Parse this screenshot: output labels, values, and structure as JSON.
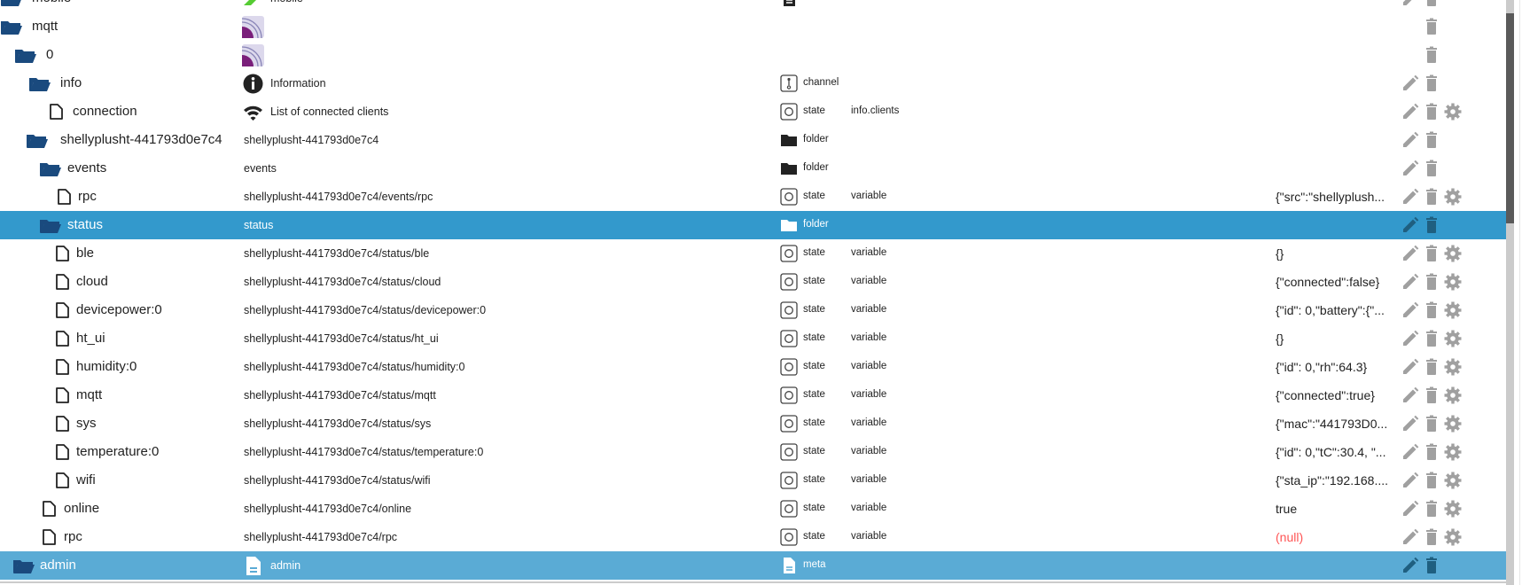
{
  "colors": {
    "selected": "#3399cc",
    "selected_alt": "#5aabd5",
    "folder": "#1a4a7e",
    "null_value": "#ff5555",
    "action_icon": "#a0a0a0"
  },
  "rows": [
    {
      "name": "mobile",
      "node_icon": "folder-icon",
      "desc": "mobile",
      "desc_icon": "mobile-logo-icon",
      "type": "meta",
      "type_icon": "meta-icon",
      "role": "",
      "value": "",
      "actions": [
        "edit",
        "delete"
      ]
    },
    {
      "name": "mqtt",
      "node_icon": "folder-icon",
      "desc": "",
      "desc_icon": "mqtt-logo-icon",
      "type": "",
      "type_icon": "",
      "role": "",
      "value": "",
      "actions": [
        "delete"
      ]
    },
    {
      "name": "0",
      "node_icon": "folder-icon",
      "desc": "",
      "desc_icon": "mqtt-logo-icon",
      "type": "",
      "type_icon": "",
      "role": "",
      "value": "",
      "actions": [
        "delete"
      ]
    },
    {
      "name": "info",
      "node_icon": "folder-icon",
      "desc": "Information",
      "desc_icon": "info-icon",
      "type": "channel",
      "type_icon": "channel-icon",
      "role": "",
      "value": "",
      "actions": [
        "edit",
        "delete"
      ]
    },
    {
      "name": "connection",
      "node_icon": "file-icon",
      "desc": "List of connected clients",
      "desc_icon": "wifi-icon",
      "type": "state",
      "type_icon": "state-icon",
      "role": "info.clients",
      "value": "",
      "actions": [
        "edit",
        "delete",
        "settings"
      ]
    },
    {
      "name": "shellyplusht-441793d0e7c4",
      "node_icon": "folder-icon",
      "desc": "shellyplusht-441793d0e7c4",
      "desc_icon": "",
      "type": "folder",
      "type_icon": "folder-type-icon",
      "role": "",
      "value": "",
      "actions": [
        "edit",
        "delete"
      ]
    },
    {
      "name": "events",
      "node_icon": "folder-icon",
      "desc": "events",
      "desc_icon": "",
      "type": "folder",
      "type_icon": "folder-type-icon",
      "role": "",
      "value": "",
      "actions": [
        "edit",
        "delete"
      ]
    },
    {
      "name": "rpc",
      "node_icon": "file-icon",
      "desc": "shellyplusht-441793d0e7c4/events/rpc",
      "desc_icon": "",
      "type": "state",
      "type_icon": "state-icon",
      "role": "variable",
      "value": "{\"src\":\"shellyplush...",
      "actions": [
        "edit",
        "delete",
        "settings"
      ]
    },
    {
      "name": "status",
      "node_icon": "folder-icon",
      "desc": "status",
      "desc_icon": "",
      "type": "folder",
      "type_icon": "folder-type-icon",
      "role": "",
      "value": "",
      "actions": [
        "edit",
        "delete"
      ],
      "selected": true
    },
    {
      "name": "ble",
      "node_icon": "file-icon",
      "desc": "shellyplusht-441793d0e7c4/status/ble",
      "desc_icon": "",
      "type": "state",
      "type_icon": "state-icon",
      "role": "variable",
      "value": "{}",
      "actions": [
        "edit",
        "delete",
        "settings"
      ]
    },
    {
      "name": "cloud",
      "node_icon": "file-icon",
      "desc": "shellyplusht-441793d0e7c4/status/cloud",
      "desc_icon": "",
      "type": "state",
      "type_icon": "state-icon",
      "role": "variable",
      "value": "{\"connected\":false}",
      "actions": [
        "edit",
        "delete",
        "settings"
      ]
    },
    {
      "name": "devicepower:0",
      "node_icon": "file-icon",
      "desc": "shellyplusht-441793d0e7c4/status/devicepower:0",
      "desc_icon": "",
      "type": "state",
      "type_icon": "state-icon",
      "role": "variable",
      "value": "{\"id\": 0,\"battery\":{\"...",
      "actions": [
        "edit",
        "delete",
        "settings"
      ]
    },
    {
      "name": "ht_ui",
      "node_icon": "file-icon",
      "desc": "shellyplusht-441793d0e7c4/status/ht_ui",
      "desc_icon": "",
      "type": "state",
      "type_icon": "state-icon",
      "role": "variable",
      "value": "{}",
      "actions": [
        "edit",
        "delete",
        "settings"
      ]
    },
    {
      "name": "humidity:0",
      "node_icon": "file-icon",
      "desc": "shellyplusht-441793d0e7c4/status/humidity:0",
      "desc_icon": "",
      "type": "state",
      "type_icon": "state-icon",
      "role": "variable",
      "value": "{\"id\": 0,\"rh\":64.3}",
      "actions": [
        "edit",
        "delete",
        "settings"
      ]
    },
    {
      "name": "mqtt",
      "node_icon": "file-icon",
      "desc": "shellyplusht-441793d0e7c4/status/mqtt",
      "desc_icon": "",
      "type": "state",
      "type_icon": "state-icon",
      "role": "variable",
      "value": "{\"connected\":true}",
      "actions": [
        "edit",
        "delete",
        "settings"
      ]
    },
    {
      "name": "sys",
      "node_icon": "file-icon",
      "desc": "shellyplusht-441793d0e7c4/status/sys",
      "desc_icon": "",
      "type": "state",
      "type_icon": "state-icon",
      "role": "variable",
      "value": "{\"mac\":\"441793D0...",
      "actions": [
        "edit",
        "delete",
        "settings"
      ]
    },
    {
      "name": "temperature:0",
      "node_icon": "file-icon",
      "desc": "shellyplusht-441793d0e7c4/status/temperature:0",
      "desc_icon": "",
      "type": "state",
      "type_icon": "state-icon",
      "role": "variable",
      "value": "{\"id\": 0,\"tC\":30.4, \"...",
      "actions": [
        "edit",
        "delete",
        "settings"
      ]
    },
    {
      "name": "wifi",
      "node_icon": "file-icon",
      "desc": "shellyplusht-441793d0e7c4/status/wifi",
      "desc_icon": "",
      "type": "state",
      "type_icon": "state-icon",
      "role": "variable",
      "value": "{\"sta_ip\":\"192.168....",
      "actions": [
        "edit",
        "delete",
        "settings"
      ]
    },
    {
      "name": "online",
      "node_icon": "file-icon",
      "desc": "shellyplusht-441793d0e7c4/online",
      "desc_icon": "",
      "type": "state",
      "type_icon": "state-icon",
      "role": "variable",
      "value": "true",
      "actions": [
        "edit",
        "delete",
        "settings"
      ]
    },
    {
      "name": "rpc",
      "node_icon": "file-icon",
      "desc": "shellyplusht-441793d0e7c4/rpc",
      "desc_icon": "",
      "type": "state",
      "type_icon": "state-icon",
      "role": "variable",
      "value": "(null)",
      "value_is_null": true,
      "actions": [
        "edit",
        "delete",
        "settings"
      ]
    },
    {
      "name": "admin",
      "node_icon": "folder-icon",
      "desc": "admin",
      "desc_icon": "document-icon",
      "type": "meta",
      "type_icon": "meta-icon",
      "role": "",
      "value": "",
      "actions": [
        "edit",
        "delete"
      ],
      "selected_alt": true
    }
  ]
}
